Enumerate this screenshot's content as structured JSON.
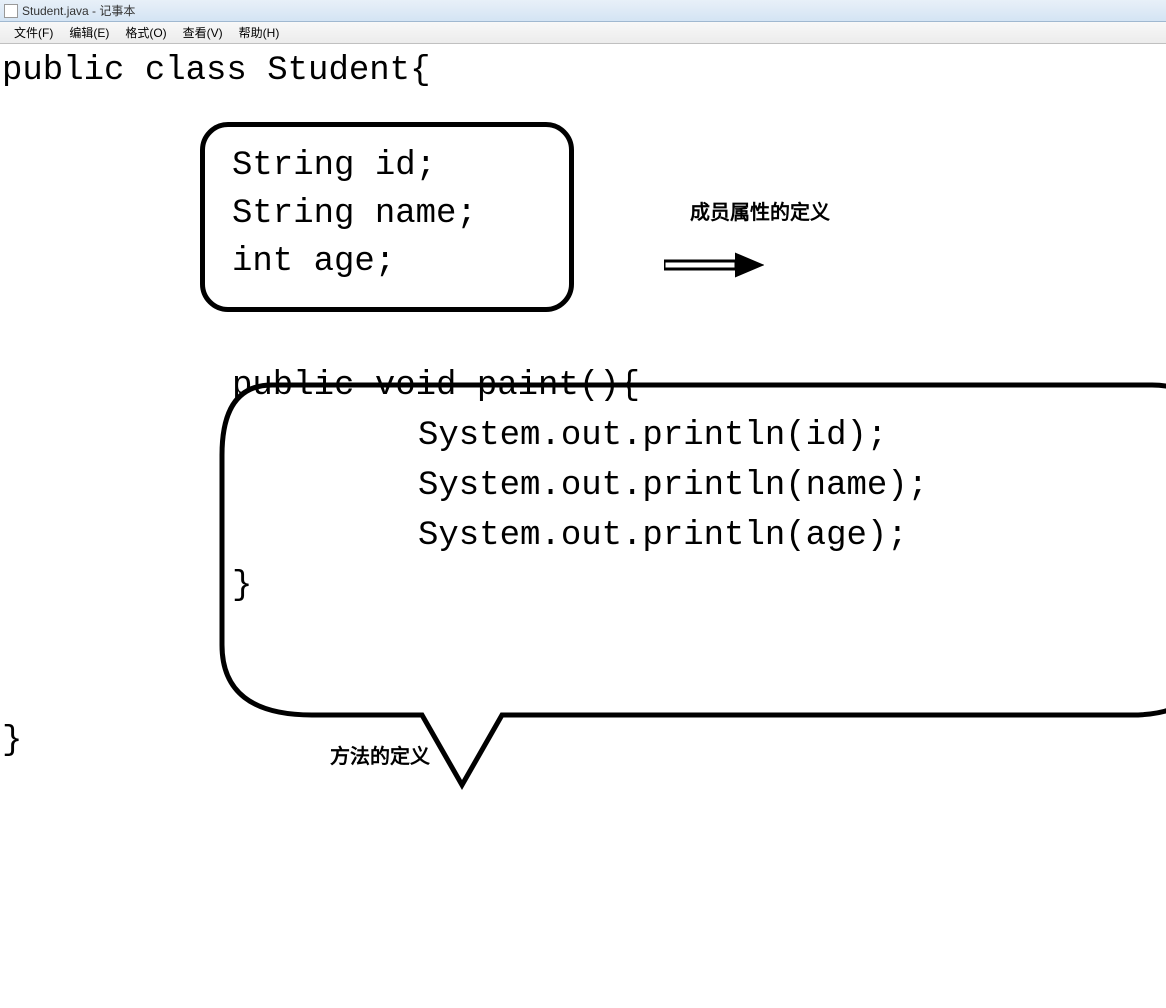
{
  "window": {
    "title": "Student.java - 记事本"
  },
  "menu": {
    "file": "文件(F)",
    "edit": "编辑(E)",
    "format": "格式(O)",
    "view": "查看(V)",
    "help": "帮助(H)"
  },
  "code": {
    "line1": "public class Student{",
    "line2": "String id;",
    "line3": "String name;",
    "line4": "int age;",
    "line5": "public void paint(){",
    "line6": "System.out.println(id);",
    "line7": "System.out.println(name);",
    "line8": "System.out.println(age);",
    "line9": "}",
    "line10": "}"
  },
  "annotations": {
    "attr_def": "成员属性的定义",
    "method_def": "方法的定义"
  }
}
